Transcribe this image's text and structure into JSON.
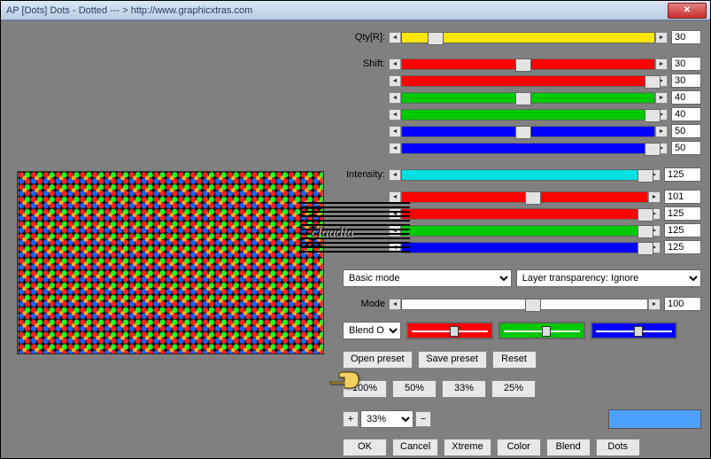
{
  "title": "AP [Dots]  Dots - Dotted    --- >  http://www.graphicxtras.com",
  "labels": {
    "qty": "Qty[R]:",
    "shift": "Shift:",
    "intensity": "Intensity:",
    "mode": "Mode",
    "blendOpt": "Blend Optio"
  },
  "sliders": {
    "qty": {
      "val": "30",
      "pct": 10,
      "color": "#ffe600"
    },
    "shift": [
      {
        "val": "30",
        "pct": 45,
        "color": "#ff0000"
      },
      {
        "val": "30",
        "pct": 96,
        "color": "#ff0000"
      },
      {
        "val": "40",
        "pct": 45,
        "color": "#00c800"
      },
      {
        "val": "40",
        "pct": 96,
        "color": "#00c800"
      },
      {
        "val": "50",
        "pct": 45,
        "color": "#0000ff"
      },
      {
        "val": "50",
        "pct": 96,
        "color": "#0000ff"
      }
    ],
    "intensity": [
      {
        "val": "125",
        "pct": 96,
        "color": "#00e0e0"
      },
      {
        "val": "101",
        "pct": 50,
        "color": "#ff0000"
      },
      {
        "val": "125",
        "pct": 96,
        "color": "#ff0000"
      },
      {
        "val": "125",
        "pct": 96,
        "color": "#00c800"
      },
      {
        "val": "125",
        "pct": 96,
        "color": "#0000ff"
      }
    ],
    "modeVal": "100",
    "modePct": 50
  },
  "selects": {
    "basic": "Basic mode",
    "layer": "Layer transparency: Ignore"
  },
  "colSliders": [
    {
      "c": "#ff0000",
      "p": 50
    },
    {
      "c": "#00c800",
      "p": 50
    },
    {
      "c": "#0000ff",
      "p": 50
    }
  ],
  "buttons": {
    "open": "Open preset",
    "save": "Save preset",
    "reset": "Reset",
    "z100": "100%",
    "z50": "50%",
    "z33": "33%",
    "z25": "25%",
    "zoom": "33%",
    "ok": "OK",
    "cancel": "Cancel",
    "xtreme": "Xtreme",
    "color": "Color",
    "blend": "Blend",
    "dots": "Dots"
  },
  "watermark": "claudia",
  "swatch": "#4da0ff"
}
